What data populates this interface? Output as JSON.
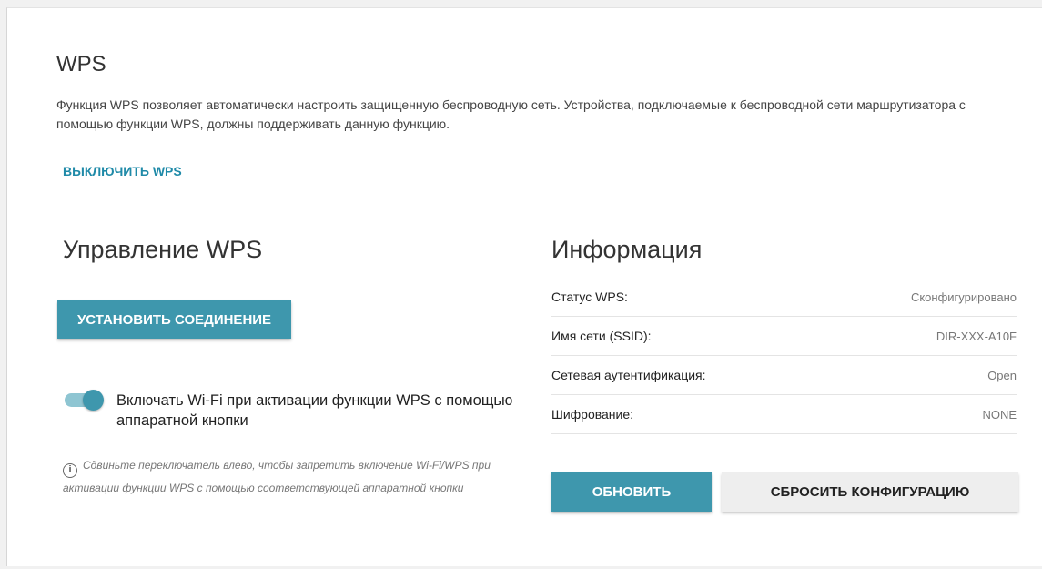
{
  "header": {
    "title": "WPS",
    "description": "Функция WPS позволяет автоматически настроить защищенную беспроводную сеть. Устройства, подключаемые к беспроводной сети маршрутизатора с помощью функции WPS, должны поддерживать данную функцию.",
    "disable_link": "ВЫКЛЮЧИТЬ WPS"
  },
  "management": {
    "title": "Управление WPS",
    "connect_button": "УСТАНОВИТЬ СОЕДИНЕНИЕ",
    "toggle": {
      "checked": true,
      "label": "Включать Wi-Fi при активации функции WPS с помощью аппаратной кнопки"
    },
    "hint": "Сдвиньте переключатель влево, чтобы запретить включение Wi-Fi/WPS при активации функции WPS с помощью соответствующей аппаратной кнопки"
  },
  "info": {
    "title": "Информация",
    "rows": [
      {
        "key": "Статус WPS:",
        "value": "Сконфигурировано"
      },
      {
        "key": "Имя сети (SSID):",
        "value": "DIR-XXX-A10F"
      },
      {
        "key": "Сетевая аутентификация:",
        "value": "Open"
      },
      {
        "key": "Шифрование:",
        "value": "NONE"
      }
    ],
    "refresh_button": "ОБНОВИТЬ",
    "reset_button": "СБРОСИТЬ КОНФИГУРАЦИЮ"
  },
  "colors": {
    "accent": "#3e97ad",
    "link": "#1f8aa8",
    "toggle_track": "#8ec5d2"
  }
}
